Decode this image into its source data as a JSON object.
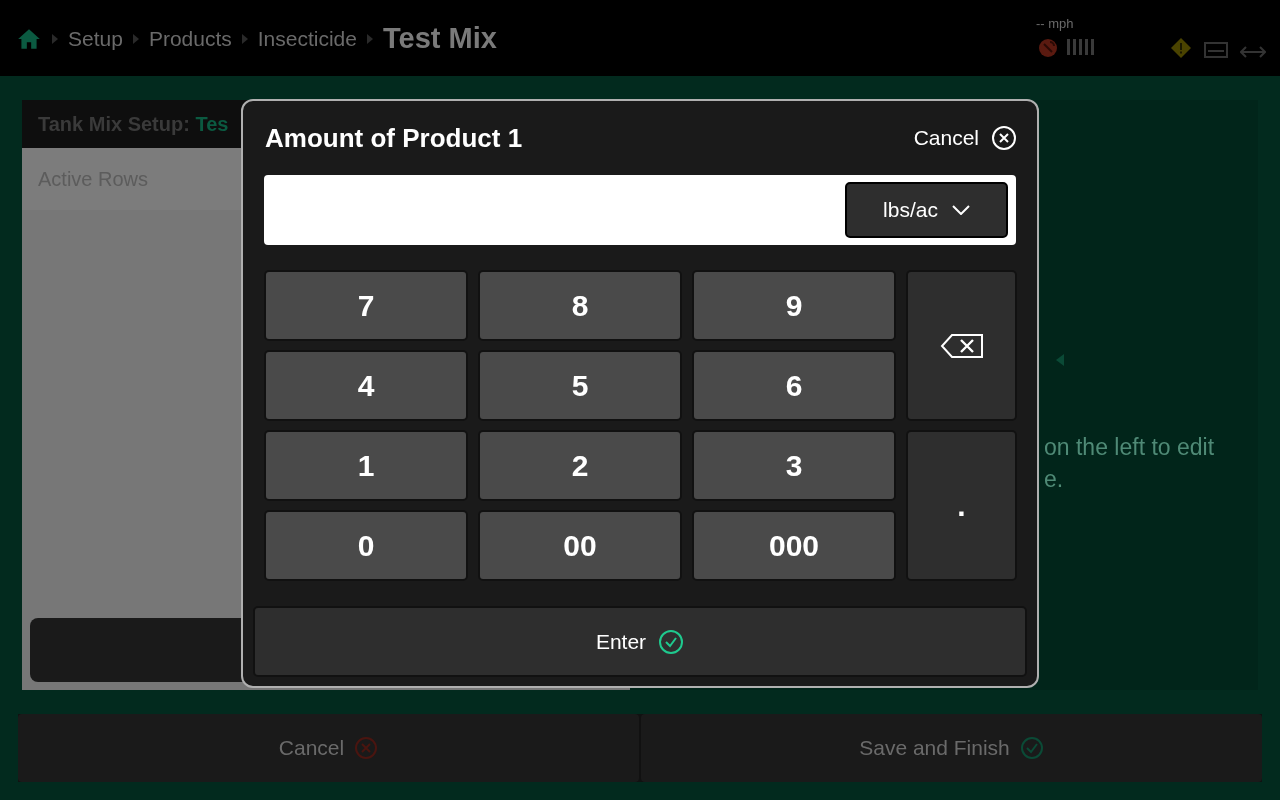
{
  "breadcrumb": [
    {
      "label": "Setup"
    },
    {
      "label": "Products"
    },
    {
      "label": "Insecticide"
    }
  ],
  "page_title": "Test Mix",
  "status": {
    "speed": "-- mph"
  },
  "tank_mix": {
    "title": "Tank Mix Setup:",
    "name": "Tes",
    "rows_label": "Active Rows"
  },
  "hint": [
    "on the left to edit",
    "e."
  ],
  "footer": {
    "cancel": "Cancel",
    "save": "Save and Finish"
  },
  "dialog": {
    "title": "Amount of Product 1",
    "cancel": "Cancel",
    "unit": "lbs/ac",
    "enter": "Enter",
    "keys": [
      {
        "kind": "digit",
        "label": "7"
      },
      {
        "kind": "digit",
        "label": "8"
      },
      {
        "kind": "digit",
        "label": "9"
      },
      {
        "kind": "backspace"
      },
      {
        "kind": "digit",
        "label": "4"
      },
      {
        "kind": "digit",
        "label": "5"
      },
      {
        "kind": "digit",
        "label": "6"
      },
      {
        "kind": "digit",
        "label": "1"
      },
      {
        "kind": "digit",
        "label": "2"
      },
      {
        "kind": "digit",
        "label": "3"
      },
      {
        "kind": "decimal",
        "label": "."
      },
      {
        "kind": "digit",
        "label": "0"
      },
      {
        "kind": "digit",
        "label": "00"
      },
      {
        "kind": "digit",
        "label": "000"
      }
    ]
  }
}
